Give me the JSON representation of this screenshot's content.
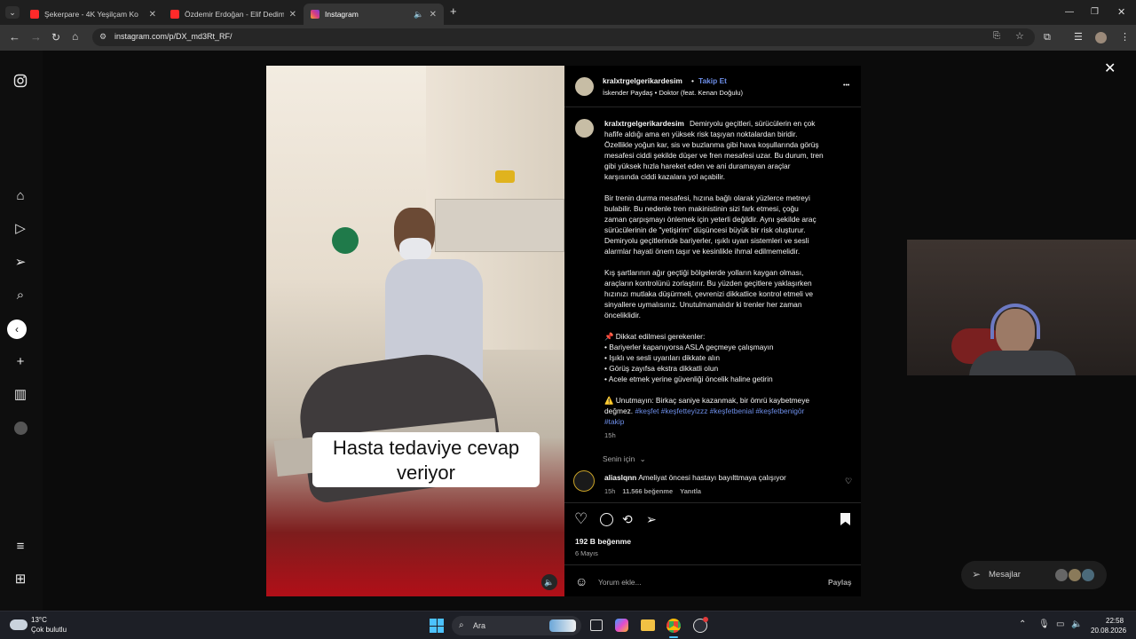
{
  "browser": {
    "tabs": [
      {
        "title": "Şekerpare - 4K Yeşilçam Ko",
        "favicon_color": "#ff2a2a"
      },
      {
        "title": "Özdemir Erdoğan - Elif Dedim B",
        "favicon_color": "#ff2a2a"
      },
      {
        "title": "Instagram",
        "favicon_color": "#d63c84"
      }
    ],
    "new_tab": "+",
    "url": "instagram.com/p/DX_md3Rt_RF/"
  },
  "post": {
    "username": "kralxtrgelgerikardesim",
    "follow_label": "Takip Et",
    "dot": "•",
    "audio": "İskender Paydaş • Doktor (feat. Kenan Doğulu)",
    "more": "•••",
    "video_caption_line1": "Hasta tedaviye cevap",
    "video_caption_line2": "veriyor",
    "caption_lines": [
      "Demiryolu geçitleri, sürücülerin en çok",
      "hafife aldığı ama en yüksek risk taşıyan noktalardan biridir.",
      "Özellikle yoğun kar, sis ve buzlanma gibi hava koşullarında görüş",
      "mesafesi ciddi şekilde düşer ve fren mesafesi uzar. Bu durum, tren",
      "gibi yüksek hızla hareket eden ve ani duramayan araçlar",
      "karşısında ciddi kazalara yol açabilir.",
      "",
      "Bir trenin durma mesafesi, hızına bağlı olarak yüzlerce metreyi",
      "bulabilir. Bu nedenle tren makinistinin sizi fark etmesi, çoğu",
      "zaman çarpışmayı önlemek için yeterli değildir. Aynı şekilde araç",
      "sürücülerinin de \"yetişirim\" düşüncesi büyük bir risk oluşturur.",
      "Demiryolu geçitlerinde bariyerler, ışıklı uyarı sistemleri ve sesli",
      "alarmlar hayati önem taşır ve kesinlikle ihmal edilmemelidir.",
      "",
      "Kış şartlarının ağır geçtiği bölgelerde yolların kaygan olması,",
      "araçların kontrolünü zorlaştırır. Bu yüzden geçitlere yaklaşırken",
      "hızınızı mutlaka düşürmeli, çevrenizi dikkatlice kontrol etmeli ve",
      "sinyallere uymalısınız. Unutulmamalıdır ki trenler her zaman",
      "önceliklidir.",
      "",
      "📌 Dikkat edilmesi gerekenler:",
      "• Bariyerler kapanıyorsa ASLA geçmeye çalışmayın",
      "• Işıklı ve sesli uyarıları dikkate alın",
      "• Görüş zayıfsa ekstra dikkatli olun",
      "• Acele etmek yerine güvenliği öncelik haline getirin",
      "",
      "⚠️ Unutmayın: Birkaç saniye kazanmak, bir ömrü kaybetmeye"
    ],
    "caption_last_plain": "değmez.",
    "hashtags_line1": "#keşfet #keşfetteyizzz #keşfetbenial #keşfetbenigör",
    "hashtags_line2": "#takip",
    "caption_time": "15h",
    "sort_label": "Senin için",
    "comment": {
      "username": "aliaslqnn",
      "text": "Ameliyat öncesi hastayı bayılttmaya çalışıyor",
      "time": "15h",
      "likes": "11.566 beğenme",
      "reply": "Yanıtla"
    },
    "likes": "192 B beğenme",
    "date": "6 Mayıs",
    "comment_placeholder": "Yorum ekle...",
    "share_label": "Paylaş"
  },
  "messages_label": "Mesajlar",
  "taskbar": {
    "temperature": "13°C",
    "weather": "Çok bulutlu",
    "search_label": "Ara",
    "time": "22:58",
    "date": "20.08.2026"
  }
}
